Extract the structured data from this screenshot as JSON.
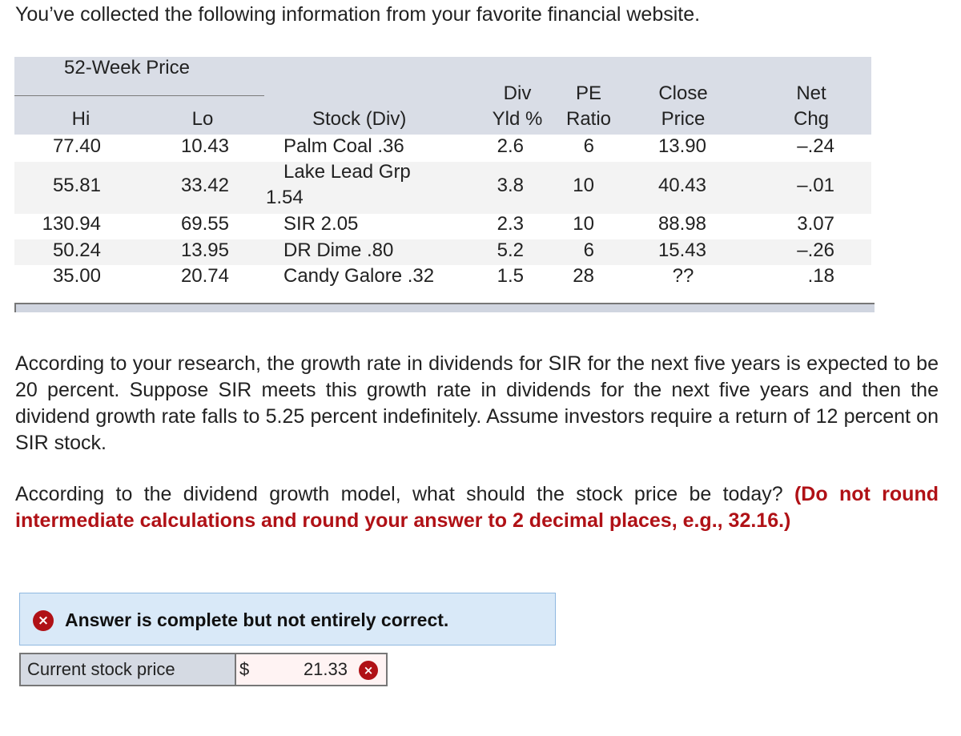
{
  "intro": "You’ve collected the following information from your favorite financial website.",
  "table": {
    "group_header": "52-Week Price",
    "headers": {
      "hi": "Hi",
      "lo": "Lo",
      "stock": "Stock (Div)",
      "div_yld_1": "Div",
      "div_yld_2": "Yld %",
      "pe_1": "PE",
      "pe_2": "Ratio",
      "close_1": "Close",
      "close_2": "Price",
      "net_1": "Net",
      "net_2": "Chg"
    },
    "rows": [
      {
        "hi": "77.40",
        "lo": "10.43",
        "stock": "Palm Coal .36",
        "stock2": "",
        "yld": "2.6",
        "pe": "6",
        "close": "13.90",
        "net": "–.24"
      },
      {
        "hi": "55.81",
        "lo": "33.42",
        "stock": "Lake Lead Grp",
        "stock2": "1.54",
        "yld": "3.8",
        "pe": "10",
        "close": "40.43",
        "net": "–.01"
      },
      {
        "hi": "130.94",
        "lo": "69.55",
        "stock": "SIR 2.05",
        "stock2": "",
        "yld": "2.3",
        "pe": "10",
        "close": "88.98",
        "net": "3.07"
      },
      {
        "hi": "50.24",
        "lo": "13.95",
        "stock": "DR Dime .80",
        "stock2": "",
        "yld": "5.2",
        "pe": "6",
        "close": "15.43",
        "net": "–.26"
      },
      {
        "hi": "35.00",
        "lo": "20.74",
        "stock": "Candy Galore .32",
        "stock2": "",
        "yld": "1.5",
        "pe": "28",
        "close": "??",
        "net": ".18"
      }
    ]
  },
  "paragraph1": "According to your research, the growth rate in dividends for SIR for the next five years is expected to be 20 percent. Suppose SIR meets this growth rate in dividends for the next five years and then the dividend growth rate falls to 5.25 percent indefinitely. Assume investors require a return of 12 percent on SIR stock.",
  "paragraph2": {
    "text": "According to the dividend growth model, what should the stock price be today? ",
    "instruction": "(Do not round intermediate calculations and round your answer to 2 decimal places, e.g., 32.16.)"
  },
  "feedback": {
    "icon": "×",
    "message": "Answer is complete but not entirely correct."
  },
  "answer": {
    "label": "Current stock price",
    "currency": "$",
    "value": "21.33",
    "status_icon": "×"
  },
  "colors": {
    "header_bg": "#d9dde6",
    "error_red": "#b01116",
    "banner_bg": "#d9e9f8"
  }
}
